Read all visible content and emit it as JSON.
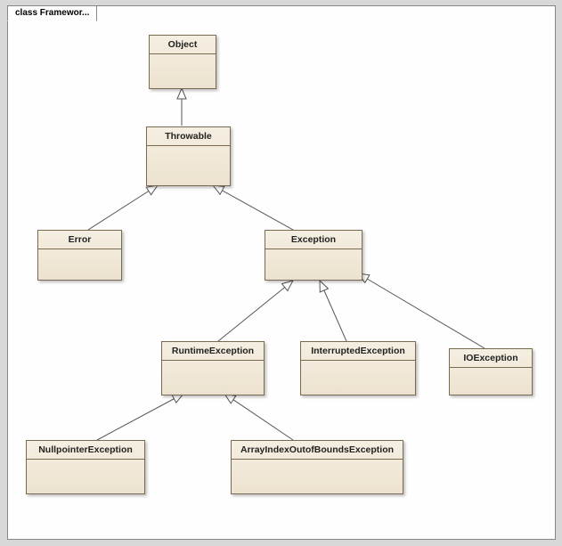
{
  "frame": {
    "title": "class Framewor..."
  },
  "classes": {
    "object": {
      "name": "Object"
    },
    "throwable": {
      "name": "Throwable"
    },
    "error": {
      "name": "Error"
    },
    "exception": {
      "name": "Exception"
    },
    "runtime": {
      "name": "RuntimeException"
    },
    "interrupted": {
      "name": "InterruptedException"
    },
    "ioexception": {
      "name": "IOException"
    },
    "nullpointer": {
      "name": "NullpointerException"
    },
    "arrayindex": {
      "name": "ArrayIndexOutofBoundsException"
    }
  },
  "chart_data": {
    "type": "uml_class_diagram",
    "title": "class Framewor...",
    "classes": [
      {
        "id": "object",
        "name": "Object"
      },
      {
        "id": "throwable",
        "name": "Throwable"
      },
      {
        "id": "error",
        "name": "Error"
      },
      {
        "id": "exception",
        "name": "Exception"
      },
      {
        "id": "runtime",
        "name": "RuntimeException"
      },
      {
        "id": "interrupted",
        "name": "InterruptedException"
      },
      {
        "id": "ioexception",
        "name": "IOException"
      },
      {
        "id": "nullpointer",
        "name": "NullpointerException"
      },
      {
        "id": "arrayindex",
        "name": "ArrayIndexOutofBoundsException"
      }
    ],
    "generalizations": [
      {
        "child": "throwable",
        "parent": "object"
      },
      {
        "child": "error",
        "parent": "throwable"
      },
      {
        "child": "exception",
        "parent": "throwable"
      },
      {
        "child": "runtime",
        "parent": "exception"
      },
      {
        "child": "interrupted",
        "parent": "exception"
      },
      {
        "child": "ioexception",
        "parent": "exception"
      },
      {
        "child": "nullpointer",
        "parent": "runtime"
      },
      {
        "child": "arrayindex",
        "parent": "runtime"
      }
    ]
  }
}
